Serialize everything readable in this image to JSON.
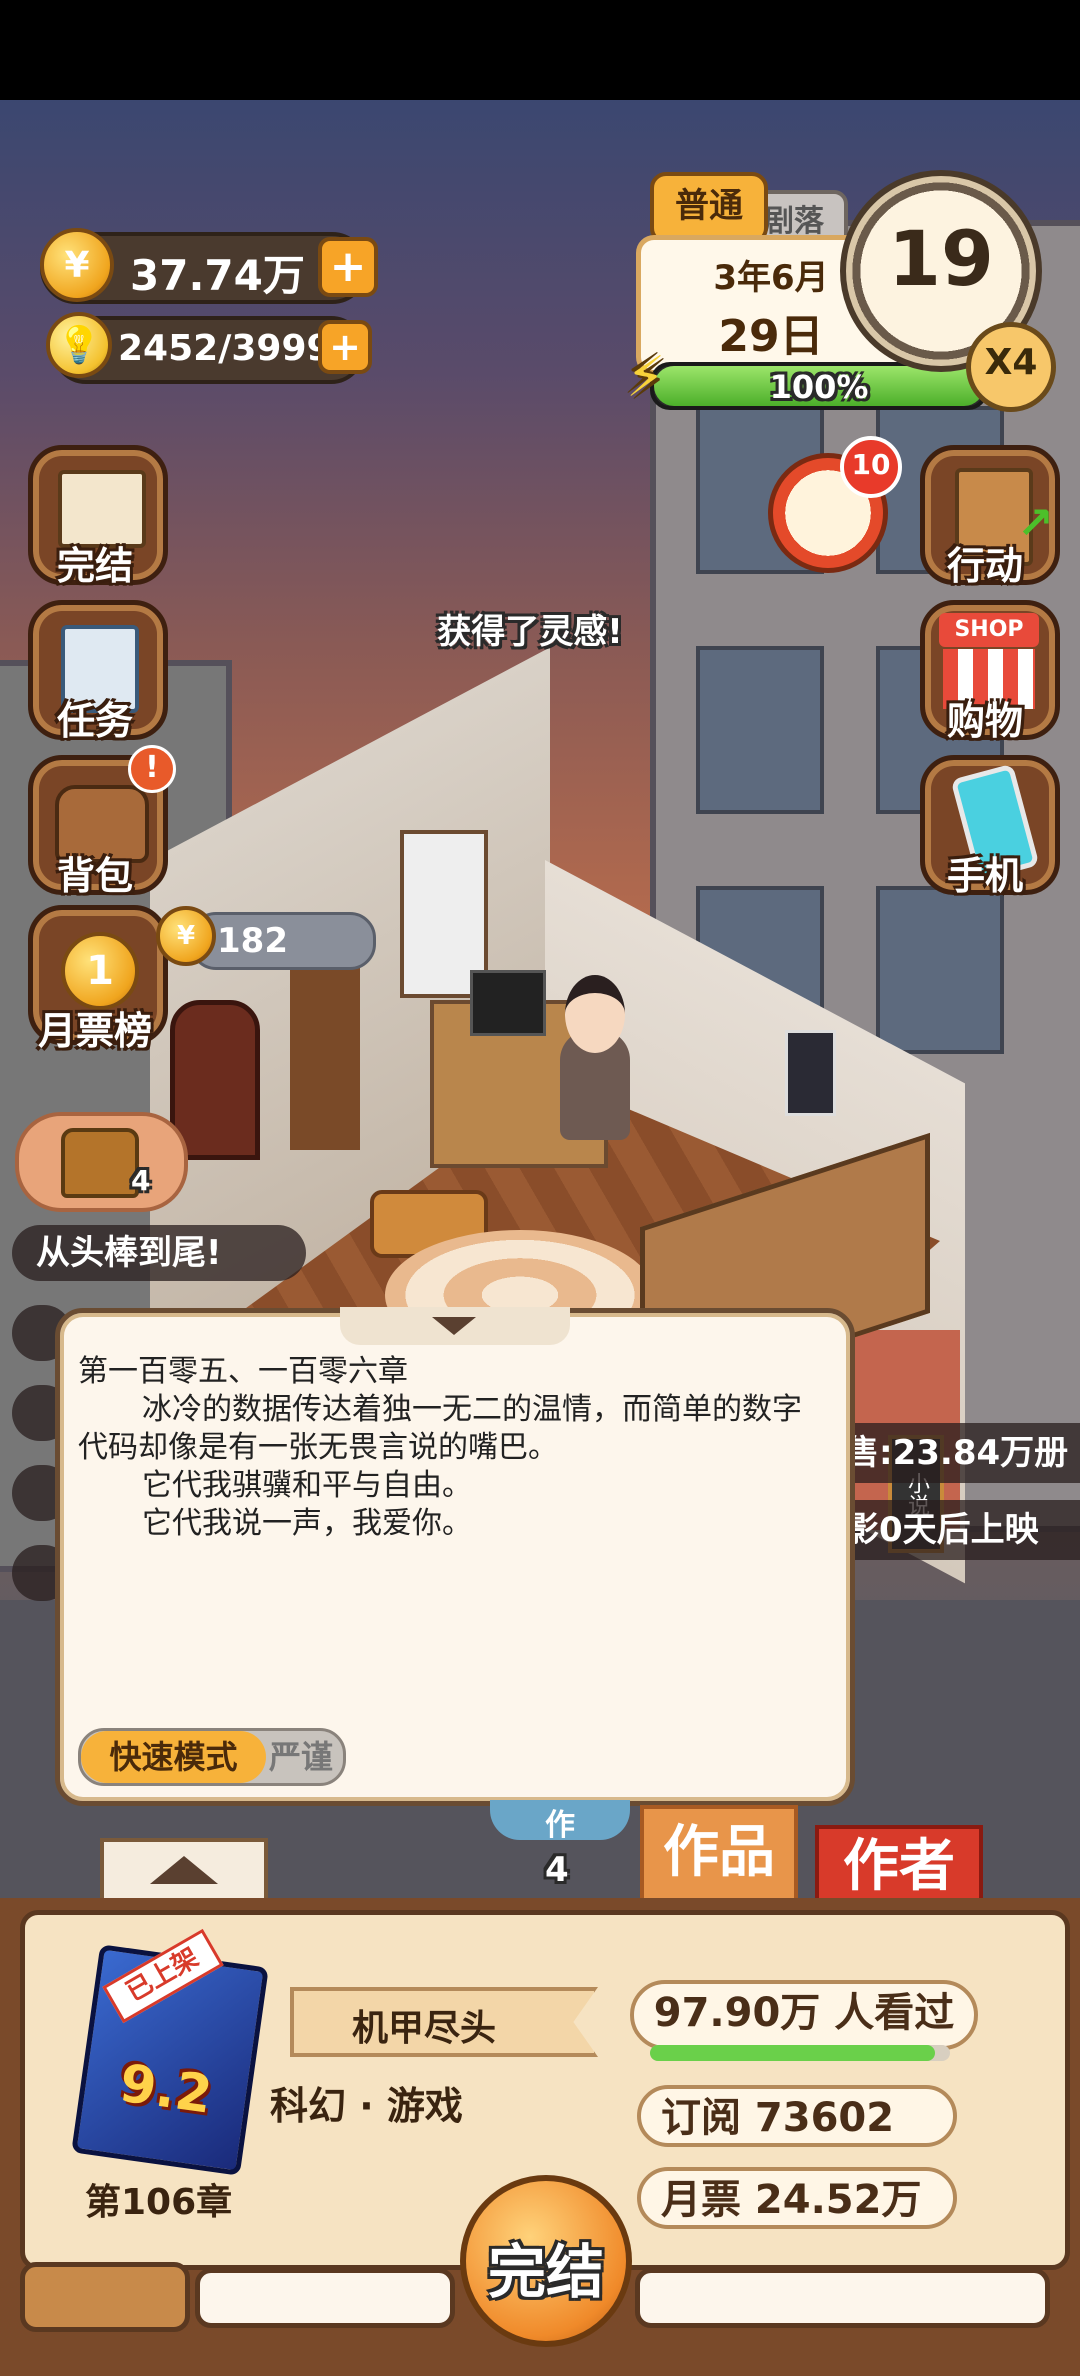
{
  "currency": {
    "coins": "37.74万",
    "inspiration": "2452/3999"
  },
  "calendar": {
    "mode": "普通",
    "mode_back": "剧落",
    "month": "3年6月",
    "day": "29日",
    "energy": "100%",
    "energy_level": 1.0,
    "hour": "19",
    "speed": "X4"
  },
  "left_menu": {
    "finish": "完结",
    "task": "任务",
    "bag": "背包",
    "monthly_rank": "月票榜",
    "rank_coins": "182",
    "chest_count": "4"
  },
  "right_menu": {
    "action": "行动",
    "shop": "购物",
    "shop_sign": "SHOP",
    "phone": "手机",
    "alarm_badge": "10"
  },
  "toast": "获得了灵感!",
  "event_tags": {
    "praise": "从头棒到尾!",
    "sales": "售:23.84万册",
    "movie": "影0天后上映",
    "poster": "小说"
  },
  "dialog": {
    "chapter": "第一百零五、一百零六章",
    "line1": "冰冷的数据传达着独一无二的温情，而简单的数字代码却像是有一张无畏言说的嘴巴。",
    "line2": "它代我骐骥和平与自由。",
    "line3": "它代我说一声，我爱你。",
    "mode_fast": "快速模式",
    "mode_strict": "严谨"
  },
  "tabs": {
    "works": "作品",
    "author": "作者",
    "count": "4",
    "hidden_tab": "作"
  },
  "book": {
    "badge": "已上架",
    "score": "9.2",
    "title": "机甲尽头",
    "genre": "科幻 · 游戏",
    "chapter": "第106章",
    "viewers": "97.90万 人看过",
    "viewers_progress": 0.95,
    "subscriptions": "订阅 73602",
    "monthly_votes": "月票 24.52万"
  },
  "finish_button": "完结"
}
